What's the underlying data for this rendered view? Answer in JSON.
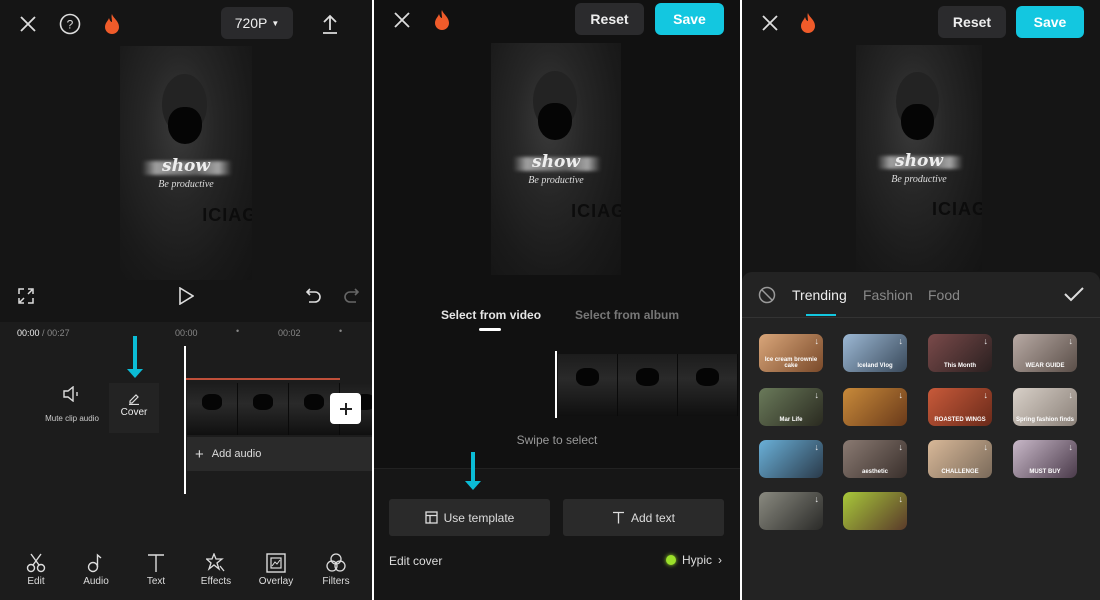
{
  "panel1": {
    "top": {
      "close_icon": "close-icon",
      "help_icon": "help-icon",
      "fire_icon": "fire-icon",
      "resolution": "720P",
      "export_icon": "export-icon"
    },
    "preview": {
      "title_text": "show",
      "subtitle": "Be productive",
      "shirt_text": "ICIAG"
    },
    "controls": {
      "fullscreen_icon": "fullscreen-icon",
      "play_icon": "play-icon",
      "undo_icon": "undo-icon",
      "redo_icon": "redo-icon"
    },
    "timeline": {
      "current_time": "00:00",
      "separator": "/",
      "total_time": "00:27",
      "ticks": [
        "00:00",
        "00:02"
      ]
    },
    "track": {
      "mute_label": "Mute clip audio",
      "cover_label": "Cover",
      "add_audio_label": "Add audio"
    },
    "toolbar": [
      {
        "label": "Edit",
        "icon": "scissors-icon"
      },
      {
        "label": "Audio",
        "icon": "music-note-icon"
      },
      {
        "label": "Text",
        "icon": "text-icon"
      },
      {
        "label": "Effects",
        "icon": "effects-star-icon"
      },
      {
        "label": "Overlay",
        "icon": "overlay-icon"
      },
      {
        "label": "Filters",
        "icon": "filters-icon"
      }
    ]
  },
  "panel2": {
    "top": {
      "reset_label": "Reset",
      "save_label": "Save"
    },
    "preview": {
      "title_text": "show",
      "subtitle": "Be productive",
      "shirt_text": "ICIAG"
    },
    "tabs": [
      {
        "label": "Select from video",
        "active": true
      },
      {
        "label": "Select from album",
        "active": false
      }
    ],
    "hint": "Swipe to select",
    "use_template_label": "Use template",
    "add_text_label": "Add text",
    "edit_cover_label": "Edit cover",
    "hypic_label": "Hypic"
  },
  "panel3": {
    "top": {
      "reset_label": "Reset",
      "save_label": "Save"
    },
    "preview": {
      "title_text": "show",
      "subtitle": "Be productive",
      "shirt_text": "ICIAG"
    },
    "tabs": [
      {
        "label": "Trending",
        "active": true
      },
      {
        "label": "Fashion",
        "active": false
      },
      {
        "label": "Food",
        "active": false
      }
    ],
    "templates": [
      {
        "caption": "Ice cream brownie cake",
        "colors": [
          "#d9a67a",
          "#7a4a2a"
        ]
      },
      {
        "caption": "Iceland Vlog",
        "colors": [
          "#9cb8d4",
          "#39495a"
        ]
      },
      {
        "caption": "This Month",
        "colors": [
          "#7a4a4a",
          "#2a2020"
        ]
      },
      {
        "caption": "WEAR GUIDE",
        "colors": [
          "#b8aaa4",
          "#5a4e48"
        ]
      },
      {
        "caption": "Mar Life",
        "colors": [
          "#6a7a5a",
          "#2a2a20"
        ]
      },
      {
        "caption": "",
        "colors": [
          "#c88a3a",
          "#6a3a1a"
        ]
      },
      {
        "caption": "ROASTED WINGS",
        "colors": [
          "#c85a3a",
          "#6a2a1a"
        ]
      },
      {
        "caption": "Spring fashion finds",
        "colors": [
          "#d8d0c8",
          "#8a8078"
        ]
      },
      {
        "caption": "",
        "colors": [
          "#6ab0d8",
          "#2a3a4a"
        ]
      },
      {
        "caption": "aesthetic",
        "colors": [
          "#8a7a72",
          "#3a302c"
        ]
      },
      {
        "caption": "CHALLENGE",
        "colors": [
          "#d8b898",
          "#7a6a5a"
        ]
      },
      {
        "caption": "MUST BUY",
        "colors": [
          "#c8b8c8",
          "#4a3a4a"
        ]
      },
      {
        "caption": "",
        "colors": [
          "#8a8a80",
          "#2a2a28"
        ]
      },
      {
        "caption": "",
        "colors": [
          "#a8c83a",
          "#5a3a2a"
        ]
      }
    ]
  },
  "colors": {
    "accent": "#13c7e0",
    "timeline_red": "#c0503a",
    "hypic_dot": "#9be02a",
    "fire": "#ef5b2a"
  }
}
